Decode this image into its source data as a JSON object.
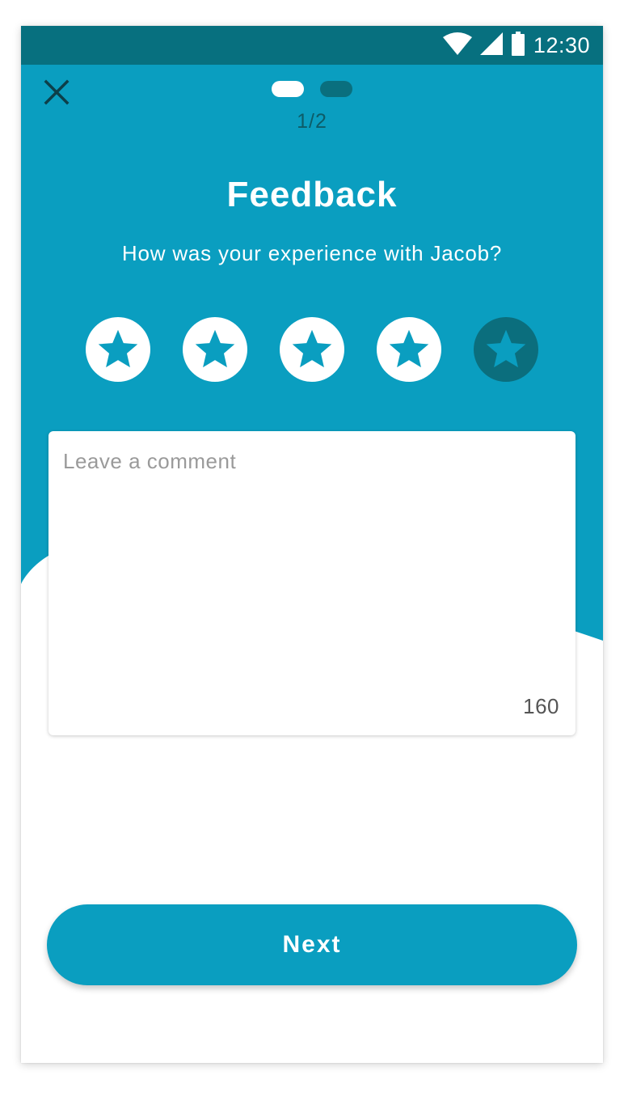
{
  "status_bar": {
    "time": "12:30",
    "icons": [
      "wifi-icon",
      "signal-icon",
      "battery-icon"
    ]
  },
  "header": {
    "close_icon": "close-icon",
    "pager": {
      "current": 1,
      "total": 2,
      "label": "1/2"
    }
  },
  "main": {
    "title": "Feedback",
    "subtitle": "How was your experience with Jacob?",
    "rating": {
      "value": 4,
      "max": 5,
      "icon": "star-icon"
    },
    "comment": {
      "placeholder": "Leave a comment",
      "value": "",
      "remaining": "160"
    },
    "next_label": "Next"
  },
  "colors": {
    "primary": "#0a9ec0",
    "status_bar": "#07707f",
    "star_off": "#0b6e7d",
    "white": "#ffffff"
  }
}
